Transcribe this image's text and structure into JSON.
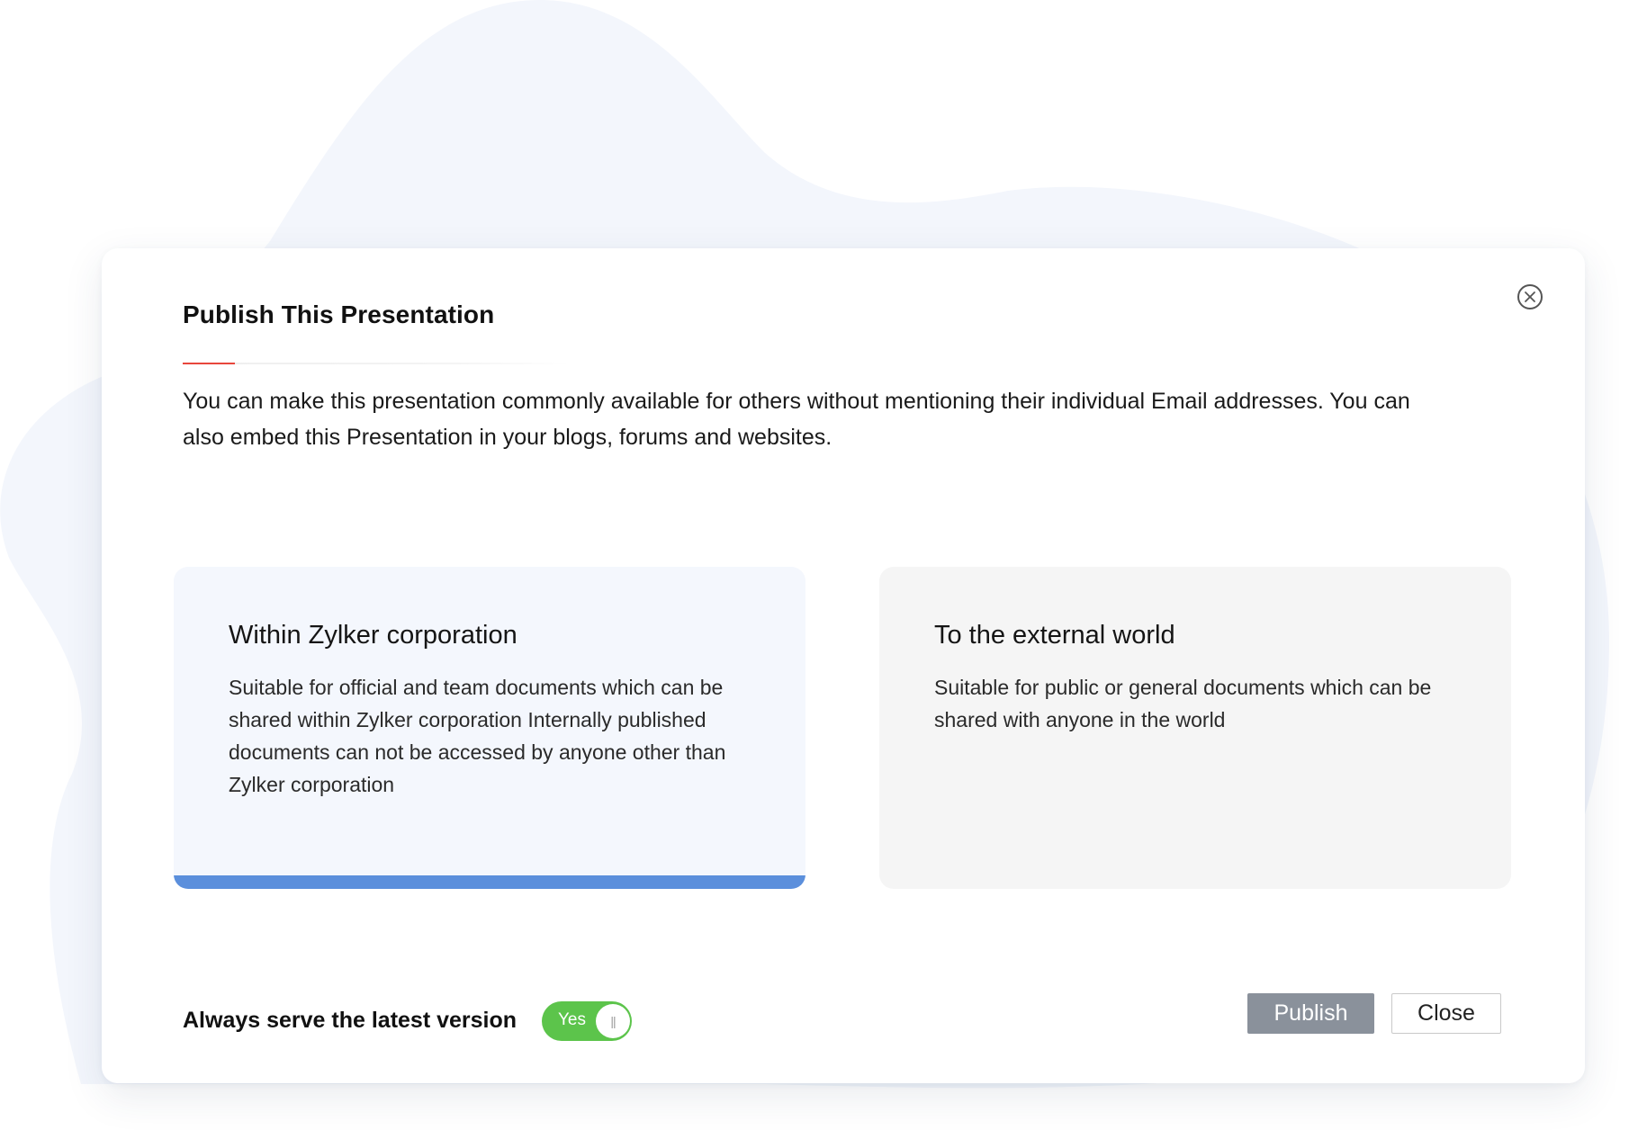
{
  "dialog": {
    "title": "Publish This Presentation",
    "description": "You can make this presentation commonly available for others without mentioning their individual Email addresses. You can also embed this Presentation in your blogs, forums and websites.",
    "close_icon": "close-circle-icon"
  },
  "options": [
    {
      "title": "Within Zylker corporation",
      "description": "Suitable for official and team documents which can be shared within Zylker corporation Internally published documents can not be accessed by anyone other than Zylker corporation",
      "selected": true
    },
    {
      "title": "To the external world",
      "description": "Suitable for public or general documents which can be shared with anyone in the world",
      "selected": false
    }
  ],
  "footer": {
    "latest_version_label": "Always serve the latest version",
    "toggle_text": "Yes",
    "toggle_on": true,
    "publish_label": "Publish",
    "close_label": "Close"
  },
  "colors": {
    "accent_red": "#e8463c",
    "selected_bar": "#5b8fdc",
    "toggle_on": "#5cc44b",
    "publish_button": "#8a919b",
    "background_blob": "#f3f6fc"
  }
}
